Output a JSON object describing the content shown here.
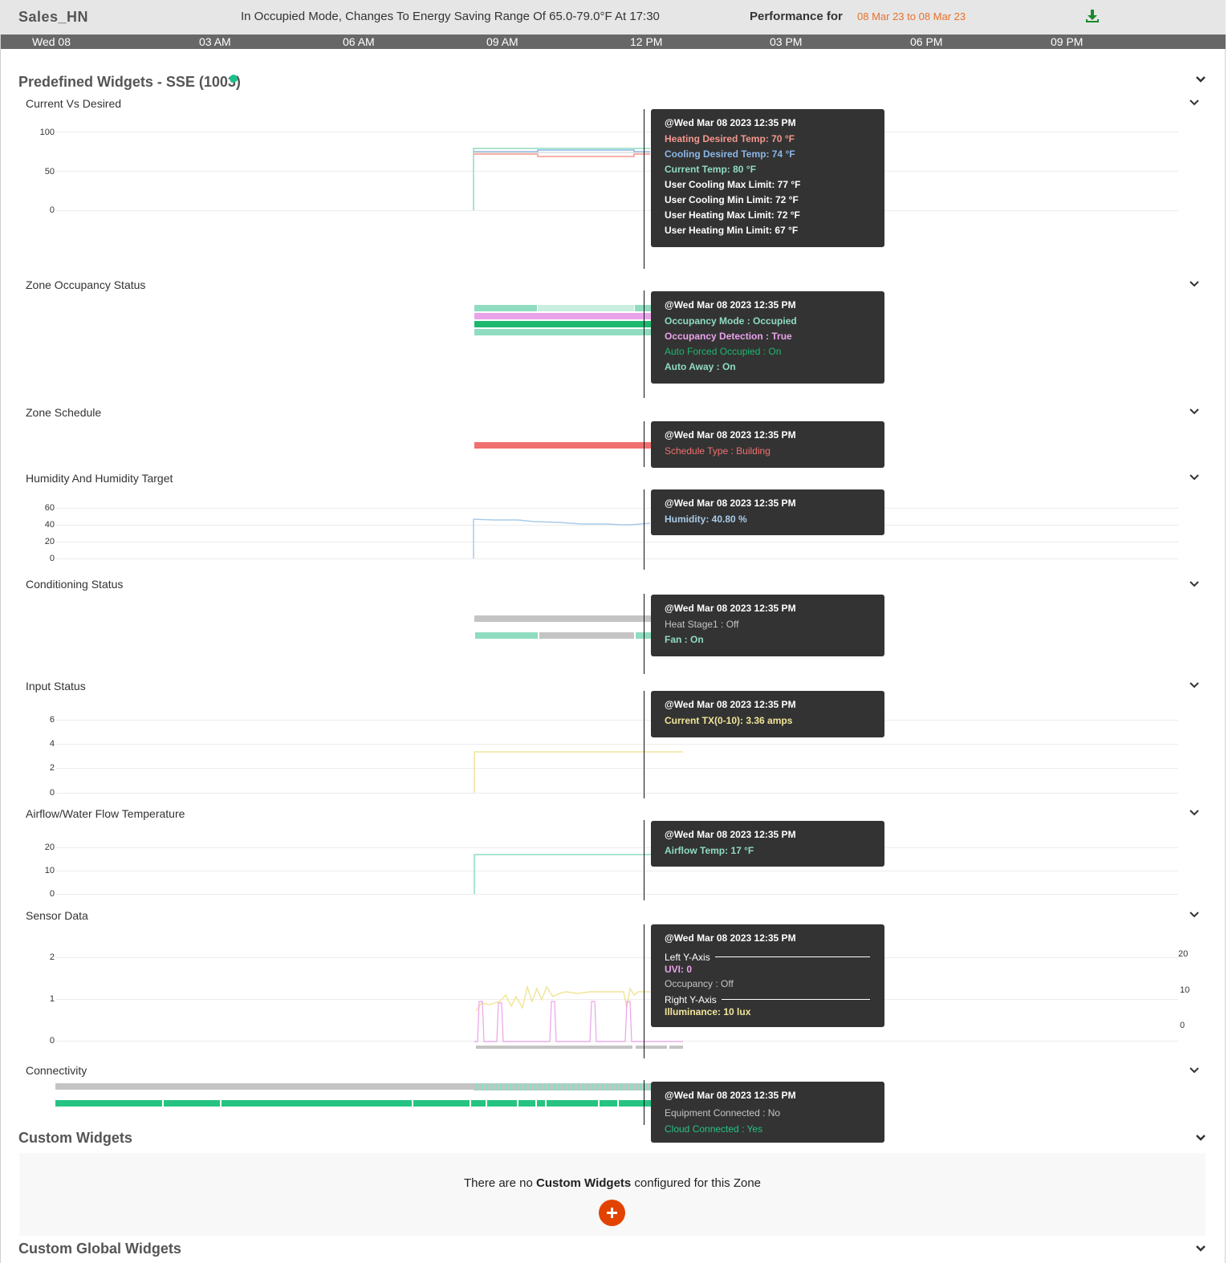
{
  "header": {
    "zone_name": "Sales_HN",
    "status": "In Occupied Mode, Changes To Energy Saving Range Of 65.0-79.0°F At 17:30",
    "performance_label": "Performance for",
    "performance_range": "08 Mar 23 to 08 Mar 23",
    "download_icon": "download-icon"
  },
  "timeline": [
    "Wed 08",
    "03 AM",
    "06 AM",
    "09 AM",
    "12 PM",
    "03 PM",
    "06 PM",
    "09 PM"
  ],
  "predefined": {
    "title": "Predefined Widgets - SSE (1003)",
    "status_color": "#1dbf8c"
  },
  "colors": {
    "heating": "#f4978e",
    "cooling": "#8ab8e6",
    "current": "#8fdcc0",
    "white": "#ffffff",
    "occupancy_mode": "#8fdcc0",
    "detection": "#eaa3ea",
    "auto_forced": "#1db86e",
    "schedule": "#f07070",
    "humidity": "#a9cbe9",
    "heat_off": "#c4c4c4",
    "fan_on": "#8fdcc0",
    "input": "#f1e59a",
    "airflow": "#8fdcc0",
    "uvi": "#eaa3ea",
    "occupancy_off": "#c4c4c4",
    "illuminance": "#f1e59a",
    "equipment": "#c4c4c4",
    "cloud": "#25c483",
    "accent": "#e24301"
  },
  "widgets": {
    "current_vs_desired": {
      "title": "Current Vs Desired",
      "ticks": [
        "100",
        "50",
        "0"
      ],
      "tooltip": {
        "date": "@Wed Mar 08 2023 12:35 PM",
        "lines": [
          "Heating Desired Temp: 70 °F",
          "Cooling Desired Temp: 74 °F",
          "Current Temp: 80 °F",
          "User Cooling Max Limit: 77 °F",
          "User Cooling Min Limit: 72 °F",
          "User Heating Max Limit: 72 °F",
          "User Heating Min Limit: 67 °F"
        ]
      }
    },
    "zone_occupancy": {
      "title": "Zone Occupancy Status",
      "tooltip": {
        "date": "@Wed Mar 08 2023 12:35 PM",
        "lines": [
          "Occupancy Mode : Occupied",
          "Occupancy Detection : True",
          "Auto Forced Occupied : On",
          "Auto Away : On"
        ]
      }
    },
    "zone_schedule": {
      "title": "Zone Schedule",
      "tooltip": {
        "date": "@Wed Mar 08 2023 12:35 PM",
        "lines": [
          "Schedule Type : Building"
        ]
      }
    },
    "humidity": {
      "title": "Humidity And Humidity Target",
      "ticks": [
        "60",
        "40",
        "20",
        "0"
      ],
      "tooltip": {
        "date": "@Wed Mar 08 2023 12:35 PM",
        "lines": [
          "Humidity: 40.80 %"
        ]
      }
    },
    "conditioning": {
      "title": "Conditioning Status",
      "tooltip": {
        "date": "@Wed Mar 08 2023 12:35 PM",
        "lines": [
          "Heat Stage1 : Off",
          "Fan : On"
        ]
      }
    },
    "input_status": {
      "title": "Input Status",
      "ticks": [
        "6",
        "4",
        "2",
        "0"
      ],
      "tooltip": {
        "date": "@Wed Mar 08 2023 12:35 PM",
        "lines": [
          "Current TX(0-10): 3.36 amps"
        ]
      }
    },
    "airflow": {
      "title": "Airflow/Water Flow Temperature",
      "ticks": [
        "20",
        "10",
        "0"
      ],
      "tooltip": {
        "date": "@Wed Mar 08 2023 12:35 PM",
        "lines": [
          "Airflow Temp: 17 °F"
        ]
      }
    },
    "sensor": {
      "title": "Sensor Data",
      "ticks_left": [
        "2",
        "1",
        "0"
      ],
      "ticks_right": [
        "20",
        "10",
        "0"
      ],
      "tooltip": {
        "date": "@Wed Mar 08 2023 12:35 PM",
        "left_axis": "Left Y-Axis",
        "uvi": "UVI: 0",
        "occupancy": "Occupancy : Off",
        "right_axis": "Right Y-Axis",
        "illuminance": "Illuminance: 10 lux"
      }
    },
    "connectivity": {
      "title": "Connectivity",
      "tooltip": {
        "date": "@Wed Mar 08 2023 12:35 PM",
        "lines": [
          "Equipment Connected : No",
          "Cloud Connected : Yes"
        ]
      }
    }
  },
  "custom": {
    "title": "Custom Widgets",
    "msg_pre": "There are no ",
    "msg_bold": "Custom Widgets",
    "msg_post": " configured for this Zone",
    "add_icon": "plus-icon"
  },
  "custom_global": {
    "title": "Custom Global Widgets"
  }
}
